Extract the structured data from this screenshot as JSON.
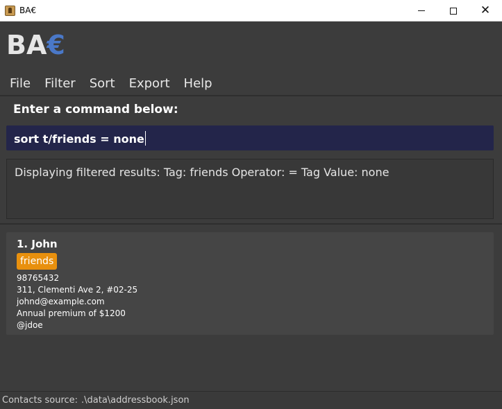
{
  "window": {
    "title": "BA€",
    "icons": {
      "app": "app-icon",
      "minimize": "minimize-icon",
      "maximize": "maximize-icon",
      "close": "close-icon"
    }
  },
  "logo": {
    "main": "BA",
    "euro": "€"
  },
  "menu": {
    "items": [
      "File",
      "Filter",
      "Sort",
      "Export",
      "Help"
    ]
  },
  "command": {
    "label": "Enter a command below:",
    "value": "sort t/friends = none"
  },
  "result": {
    "message": "Displaying filtered results: Tag: friends Operator: = Tag Value: none"
  },
  "contacts": [
    {
      "index_name": "1. John",
      "tags": [
        "friends"
      ],
      "phone": "98765432",
      "address": "311, Clementi Ave 2, #02-25",
      "email": "johnd@example.com",
      "premium": "Annual premium of $1200",
      "handle": "@jdoe"
    }
  ],
  "status": {
    "label": "Contacts source:",
    "path": ".\\data\\addressbook.json"
  },
  "colors": {
    "background": "#3c3c3c",
    "command_box": "#23254a",
    "tag": "#e8900e",
    "logo_accent": "#4a78c8"
  }
}
